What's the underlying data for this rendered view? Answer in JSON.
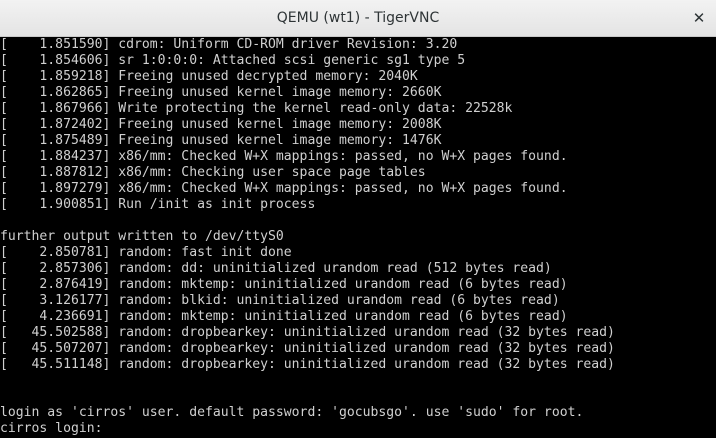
{
  "window": {
    "title": "QEMU (wt1) - TigerVNC",
    "close_glyph": "✕"
  },
  "console": {
    "lines": [
      "[    1.851590] cdrom: Uniform CD-ROM driver Revision: 3.20",
      "[    1.854606] sr 1:0:0:0: Attached scsi generic sg1 type 5",
      "[    1.859218] Freeing unused decrypted memory: 2040K",
      "[    1.862865] Freeing unused kernel image memory: 2660K",
      "[    1.867966] Write protecting the kernel read-only data: 22528k",
      "[    1.872402] Freeing unused kernel image memory: 2008K",
      "[    1.875489] Freeing unused kernel image memory: 1476K",
      "[    1.884237] x86/mm: Checked W+X mappings: passed, no W+X pages found.",
      "[    1.887812] x86/mm: Checking user space page tables",
      "[    1.897279] x86/mm: Checked W+X mappings: passed, no W+X pages found.",
      "[    1.900851] Run /init as init process",
      "",
      "further output written to /dev/ttyS0",
      "[    2.850781] random: fast init done",
      "[    2.857306] random: dd: uninitialized urandom read (512 bytes read)",
      "[    2.876419] random: mktemp: uninitialized urandom read (6 bytes read)",
      "[    3.126177] random: blkid: uninitialized urandom read (6 bytes read)",
      "[    4.236691] random: mktemp: uninitialized urandom read (6 bytes read)",
      "[   45.502588] random: dropbearkey: uninitialized urandom read (32 bytes read)",
      "[   45.507207] random: dropbearkey: uninitialized urandom read (32 bytes read)",
      "[   45.511148] random: dropbearkey: uninitialized urandom read (32 bytes read)",
      "",
      "",
      "login as 'cirros' user. default password: 'gocubsgo'. use 'sudo' for root.",
      "cirros login: "
    ]
  }
}
